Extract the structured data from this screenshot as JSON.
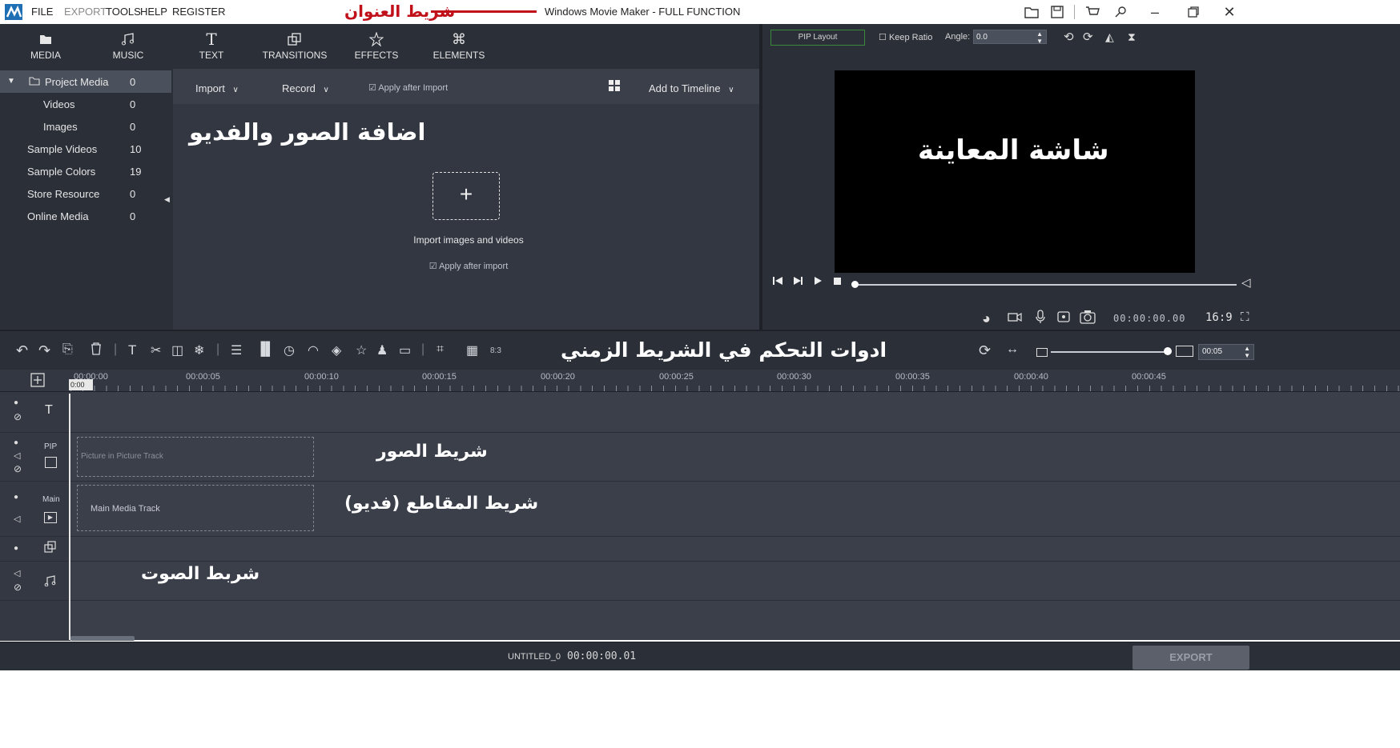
{
  "menu": {
    "items": [
      "FILE",
      "EXPORT",
      "TOOLS",
      "HELP",
      "REGISTER"
    ],
    "annotation": "شريط العنوان"
  },
  "window": {
    "title": "Windows Movie Maker - FULL FUNCTION",
    "minimize": "–",
    "close": "✕"
  },
  "tabs": [
    {
      "label": "MEDIA",
      "icon": "folder-icon"
    },
    {
      "label": "MUSIC",
      "icon": "music-note-icon"
    },
    {
      "label": "TEXT",
      "icon": "text-icon"
    },
    {
      "label": "TRANSITIONS",
      "icon": "transitions-icon"
    },
    {
      "label": "EFFECTS",
      "icon": "effects-icon"
    },
    {
      "label": "ELEMENTS",
      "icon": "elements-icon"
    }
  ],
  "sidebar": {
    "items": [
      {
        "label": "Project Media",
        "count": "0"
      },
      {
        "label": "Videos",
        "count": "0"
      },
      {
        "label": "Images",
        "count": "0"
      },
      {
        "label": "Sample Videos",
        "count": "10"
      },
      {
        "label": "Sample Colors",
        "count": "19"
      },
      {
        "label": "Store Resource",
        "count": "0"
      },
      {
        "label": "Online Media",
        "count": "0"
      }
    ]
  },
  "media_toolbar": {
    "import_label": "Import",
    "record_label": "Record",
    "apply_after_import": "Apply after Import",
    "add_to_timeline": "Add to Timeline"
  },
  "media_area": {
    "annotation": "اضافة الصور والفديو",
    "import_text": "Import images and videos",
    "apply_after_import": "Apply after import"
  },
  "preview": {
    "pip_layout": "PIP Layout",
    "keep_ratio": "Keep Ratio",
    "angle_label": "Angle:",
    "angle_value": "0.0",
    "annotation": "شاشة المعاينة",
    "timecode": "00:00:00.00",
    "aspect": "16:9"
  },
  "timeline_toolbar": {
    "annotation": "ادوات التحكم في الشريط الزمني",
    "zoom_value": "00:05",
    "ratio_label": "8:3"
  },
  "ruler": {
    "ticks": [
      "00:00:00",
      "00:00:05",
      "00:00:10",
      "00:00:15",
      "00:00:20",
      "00:00:25",
      "00:00:30",
      "00:00:35",
      "00:00:40",
      "00:00:45"
    ],
    "playhead": "0:00"
  },
  "tracks": {
    "pip_label": "PIP",
    "main_label": "Main",
    "pip_placeholder": "Picture in Picture Track",
    "main_placeholder": "Main Media Track",
    "pip_annotation": "شريط الصور",
    "main_annotation": "شريط المقاطع (فديو)",
    "audio_annotation": "شربط الصوت"
  },
  "status": {
    "project_name": "UNTITLED_0",
    "timecode": "00:00:00.01",
    "export_label": "EXPORT"
  },
  "colors": {
    "annotation_red": "#c0101a",
    "panel_dark": "#2b2f38",
    "accent_green": "#3a8a3a"
  }
}
